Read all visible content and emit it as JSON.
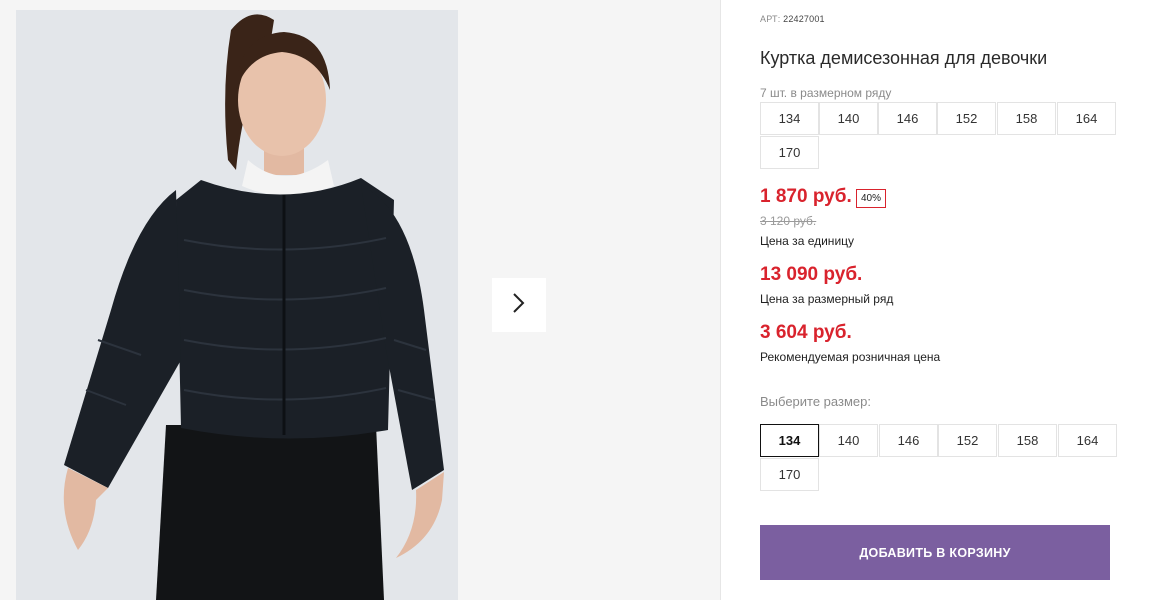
{
  "product": {
    "article_label": "АРТ:",
    "article_number": "22427001",
    "title": "Куртка демисезонная для девочки",
    "series_note": "7 шт. в размерном ряду",
    "series_sizes": [
      "134",
      "140",
      "146",
      "152",
      "158",
      "164",
      "170"
    ]
  },
  "pricing": {
    "unit_price": "1 870 руб.",
    "discount_badge": "40%",
    "old_price": "3 120 руб.",
    "unit_caption": "Цена за единицу",
    "series_price": "13 090 руб.",
    "series_caption": "Цена за размерный ряд",
    "retail_price": "3 604 руб.",
    "retail_caption": "Рекомендуемая розничная цена"
  },
  "size_picker": {
    "label": "Выберите размер:",
    "options": [
      "134",
      "140",
      "146",
      "152",
      "158",
      "164",
      "170"
    ],
    "selected": "134"
  },
  "cart": {
    "button_label": "ДОБАВИТЬ В КОРЗИНУ",
    "button_color": "#7b5fa0"
  },
  "colors": {
    "accent_red": "#d9232d"
  },
  "icons": {
    "next": "chevron-right-icon"
  }
}
